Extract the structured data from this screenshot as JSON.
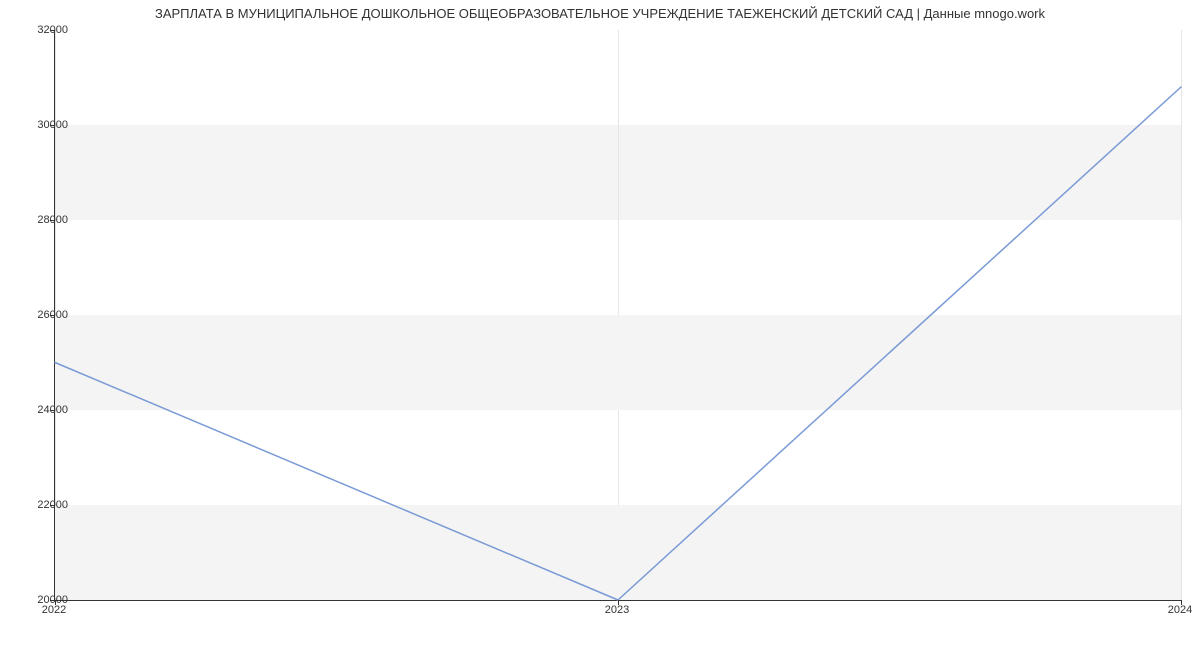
{
  "chart_data": {
    "type": "line",
    "title": "ЗАРПЛАТА В МУНИЦИПАЛЬНОЕ ДОШКОЛЬНОЕ ОБЩЕОБРАЗОВАТЕЛЬНОЕ УЧРЕЖДЕНИЕ ТАЕЖЕНСКИЙ ДЕТСКИЙ САД | Данные mnogo.work",
    "x": [
      2022,
      2023,
      2024
    ],
    "values": [
      25000,
      20000,
      30800
    ],
    "x_ticks": [
      2022,
      2023,
      2024
    ],
    "y_ticks": [
      20000,
      22000,
      24000,
      26000,
      28000,
      30000,
      32000
    ],
    "xlim": [
      2022,
      2024
    ],
    "ylim": [
      20000,
      32000
    ],
    "xlabel": "",
    "ylabel": "",
    "line_color": "#7a9ad6",
    "grid_bands": true
  }
}
